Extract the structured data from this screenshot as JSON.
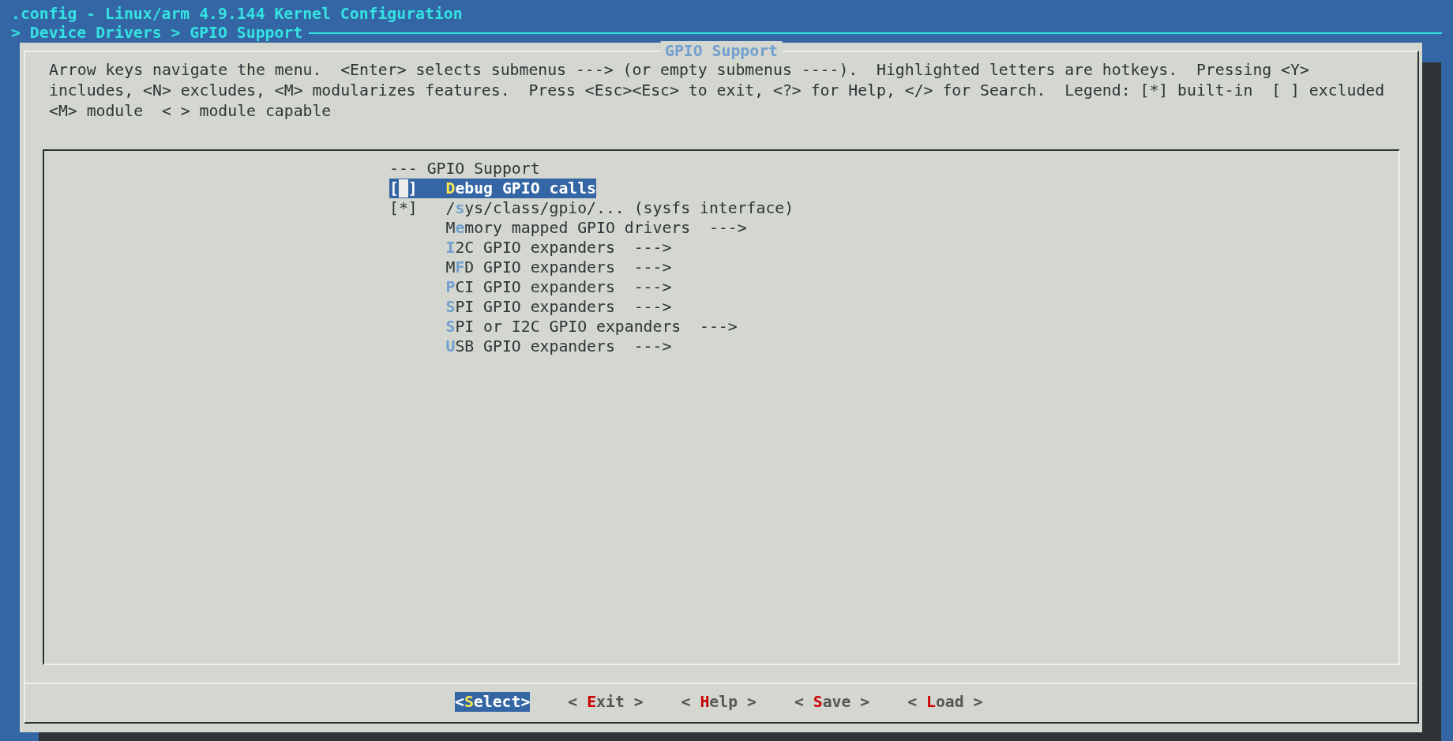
{
  "window": {
    "title": ".config - Linux/arm 4.9.144 Kernel Configuration"
  },
  "breadcrumb": "> Device Drivers > GPIO Support",
  "dialog": {
    "title": "GPIO Support",
    "help_lines": [
      "Arrow keys navigate the menu.  <Enter> selects submenus ---> (or empty submenus ----).  Highlighted letters are hotkeys.  Pressing <Y>",
      "includes, <N> excludes, <M> modularizes features.  Press <Esc><Esc> to exit, <?> for Help, </> for Search.  Legend: [*] built-in  [ ] excluded",
      "<M> module  < > module capable"
    ]
  },
  "menu": {
    "items": [
      {
        "kind": "comment",
        "text": "--- GPIO Support",
        "selected": false
      },
      {
        "kind": "bool",
        "checkbox": "[ ]",
        "hotkey": "D",
        "rest": "ebug GPIO calls",
        "selected": true
      },
      {
        "kind": "bool",
        "checkbox": "[*]",
        "pre": "/",
        "hotkey": "s",
        "rest": "ys/class/gpio/... (sysfs interface)",
        "selected": false
      },
      {
        "kind": "submenu",
        "pre": "M",
        "hotkey": "e",
        "rest": "mory mapped GPIO drivers  --->",
        "selected": false
      },
      {
        "kind": "submenu",
        "hotkey": "I",
        "rest": "2C GPIO expanders  --->",
        "selected": false
      },
      {
        "kind": "submenu",
        "pre": "M",
        "hotkey": "F",
        "rest": "D GPIO expanders  --->",
        "selected": false
      },
      {
        "kind": "submenu",
        "hotkey": "P",
        "rest": "CI GPIO expanders  --->",
        "selected": false
      },
      {
        "kind": "submenu",
        "hotkey": "S",
        "rest": "PI GPIO expanders  --->",
        "selected": false
      },
      {
        "kind": "submenu",
        "hotkey": "S",
        "rest": "PI or I2C GPIO expanders  --->",
        "selected": false
      },
      {
        "kind": "submenu",
        "hotkey": "U",
        "rest": "SB GPIO expanders  --->",
        "selected": false
      }
    ]
  },
  "buttons": [
    {
      "pre": "<",
      "hotkey": "S",
      "rest": "elect>",
      "selected": true
    },
    {
      "pre": "< ",
      "hotkey": "E",
      "rest": "xit >",
      "selected": false
    },
    {
      "pre": "< ",
      "hotkey": "H",
      "rest": "elp >",
      "selected": false
    },
    {
      "pre": "< ",
      "hotkey": "S",
      "rest": "ave >",
      "selected": false
    },
    {
      "pre": "< ",
      "hotkey": "L",
      "rest": "oad >",
      "selected": false
    }
  ]
}
